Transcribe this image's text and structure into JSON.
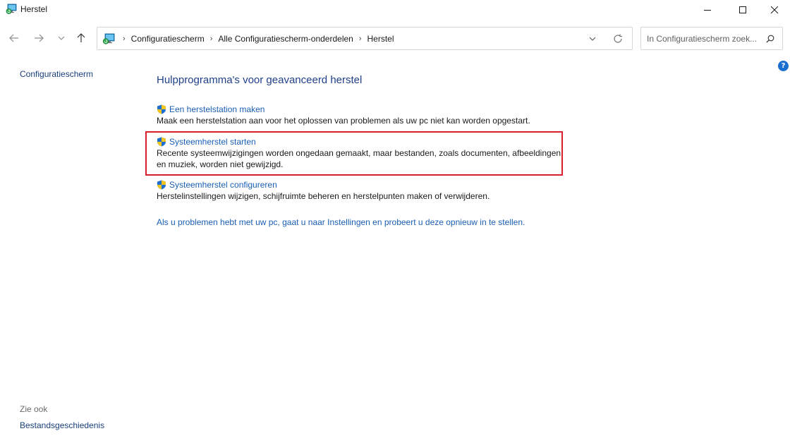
{
  "window": {
    "title": "Herstel"
  },
  "address": {
    "crumbs": [
      "Configuratiescherm",
      "Alle Configuratiescherm-onderdelen",
      "Herstel"
    ]
  },
  "search": {
    "placeholder": "In Configuratiescherm zoek..."
  },
  "sidebar": {
    "home_label": "Configuratiescherm",
    "see_also_label": "Zie ook",
    "history_label": "Bestandsgeschiedenis"
  },
  "main": {
    "title": "Hulpprogramma's voor geavanceerd herstel",
    "tasks": [
      {
        "label": "Een herstelstation maken",
        "description": "Maak een herstelstation aan voor het oplossen van problemen als uw pc niet kan worden opgestart."
      },
      {
        "label": "Systeemherstel starten",
        "description": "Recente systeemwijzigingen worden ongedaan gemaakt, maar bestanden, zoals documenten, afbeeldingen en muziek, worden niet gewijzigd."
      },
      {
        "label": "Systeemherstel configureren",
        "description": "Herstelinstellingen wijzigen, schijfruimte beheren en herstelpunten maken of verwijderen."
      }
    ],
    "settings_link": "Als u problemen hebt met uw pc, gaat u naar Instellingen en probeert u deze opnieuw in te stellen."
  },
  "icons": {
    "app": "recovery-monitor-icon",
    "shield": "uac-shield-icon",
    "help": "help-icon"
  },
  "colors": {
    "link": "#1a5fb4",
    "title": "#1f3f8a",
    "highlight": "#d8202f"
  }
}
